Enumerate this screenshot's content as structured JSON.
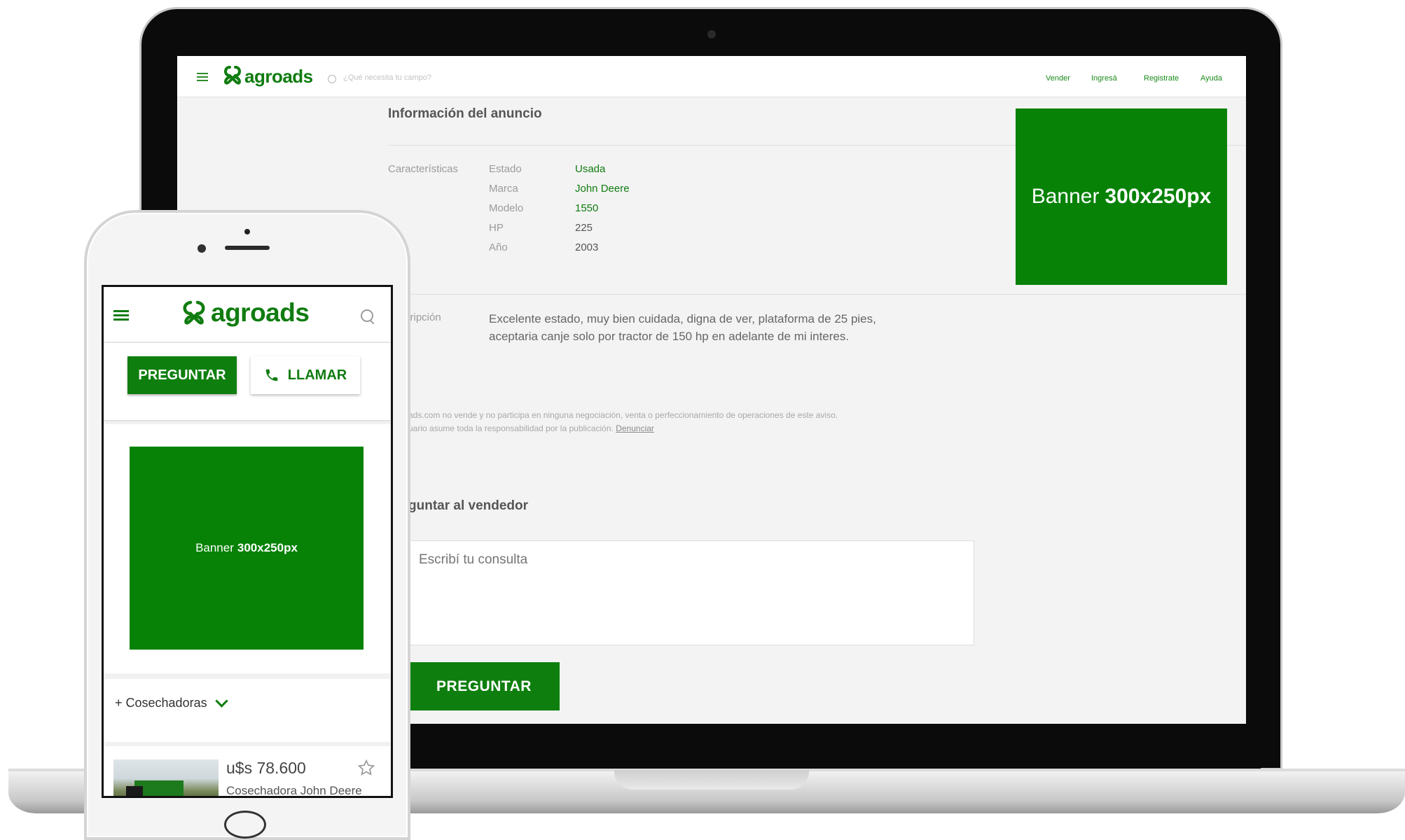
{
  "brand": {
    "name": "agroads",
    "color": "#107c10"
  },
  "desktop": {
    "search": {
      "placeholder": "¿Qué necesita tu campo?"
    },
    "nav": [
      "Vender",
      "Ingresá",
      "Registrate",
      "Ayuda"
    ],
    "section_title": "Información del anuncio",
    "characteristics_label": "Características",
    "specs": [
      {
        "label": "Estado",
        "value": "Usada",
        "link": true
      },
      {
        "label": "Marca",
        "value": "John Deere",
        "link": true
      },
      {
        "label": "Modelo",
        "value": "1550",
        "link": true
      },
      {
        "label": "HP",
        "value": "225",
        "link": false
      },
      {
        "label": "Año",
        "value": "2003",
        "link": false
      }
    ],
    "description_label": "cripción",
    "description": "Excelente estado, muy bien cuidada, digna de ver, plataforma de 25 pies, aceptaria canje solo por tractor de 150 hp en adelante de mi interes.",
    "legal_line1": "ads.com no vende y no participa en ninguna negociación, venta o perfeccionamiento de operaciones de este aviso.",
    "legal_line2": "uario asume toda la responsabilidad por la publicación.",
    "report_link": "Denunciar",
    "ask_title": "guntar al vendedor",
    "ask_placeholder": "Escribí tu consulta",
    "ask_button": "PREGUNTAR",
    "banner": {
      "prefix": "Banner",
      "size": "300x250px"
    }
  },
  "mobile": {
    "ask_button": "PREGUNTAR",
    "call_button": "LLAMAR",
    "banner": {
      "prefix": "Banner",
      "size": "300x250px"
    },
    "category": "+ Cosechadoras",
    "listing": {
      "price": "u$s 78.600",
      "title": "Cosechadora John Deere"
    }
  },
  "icons": [
    "menu-icon",
    "search-icon",
    "phone-icon",
    "chevron-down-icon",
    "star-icon",
    "agroads-logo-icon"
  ]
}
